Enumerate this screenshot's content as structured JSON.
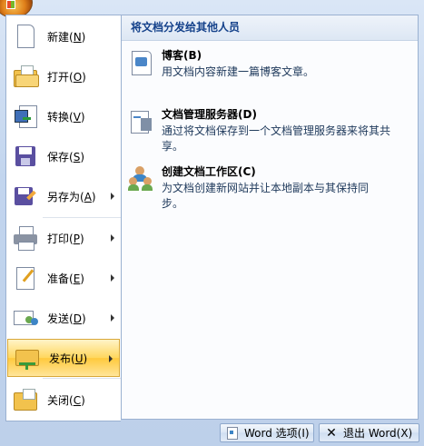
{
  "menu": {
    "items": [
      {
        "name": "menu-item-new",
        "icon": "new-document-icon",
        "label": "新建(",
        "key": "N",
        "end": ")",
        "arrow": false
      },
      {
        "name": "menu-item-open",
        "icon": "open-folder-icon",
        "label": "打开(",
        "key": "O",
        "end": ")",
        "arrow": false
      },
      {
        "name": "menu-item-convert",
        "icon": "convert-icon",
        "label": "转换(",
        "key": "V",
        "end": ")",
        "arrow": false
      },
      {
        "name": "menu-item-save",
        "icon": "save-icon",
        "label": "保存(",
        "key": "S",
        "end": ")",
        "arrow": false
      },
      {
        "name": "menu-item-save-as",
        "icon": "save-as-icon",
        "label": "另存为(",
        "key": "A",
        "end": ")",
        "arrow": true
      },
      {
        "name": "menu-item-print",
        "icon": "printer-icon",
        "label": "打印(",
        "key": "P",
        "end": ")",
        "arrow": true
      },
      {
        "name": "menu-item-prepare",
        "icon": "prepare-icon",
        "label": "准备(",
        "key": "E",
        "end": ")",
        "arrow": true
      },
      {
        "name": "menu-item-send",
        "icon": "send-icon",
        "label": "发送(",
        "key": "D",
        "end": ")",
        "arrow": true
      },
      {
        "name": "menu-item-publish",
        "icon": "publish-icon",
        "label": "发布(",
        "key": "U",
        "end": ")",
        "arrow": true,
        "selected": true
      },
      {
        "name": "menu-item-close",
        "icon": "close-folder-icon",
        "label": "关闭(",
        "key": "C",
        "end": ")",
        "arrow": false
      }
    ]
  },
  "panel": {
    "title": "将文档分发给其他人员",
    "options": [
      {
        "name": "option-blog",
        "icon": "blog-icon",
        "title": "博客(B)",
        "desc": "用文档内容新建一篇博客文章。"
      },
      {
        "name": "option-doc-server",
        "icon": "document-server-icon",
        "title": "文档管理服务器(D)",
        "desc": "通过将文档保存到一个文档管理服务器来将其共享。"
      },
      {
        "name": "option-workspace",
        "icon": "workspace-icon",
        "title": "创建文档工作区(C)",
        "desc": "为文档创建新网站并让本地副本与其保持同步。"
      }
    ]
  },
  "footer": {
    "options_label": "Word 选项(I)",
    "exit_label": "退出 Word(X)"
  },
  "colors": {
    "selected_gradient_mid": "#ffd75e",
    "panel_title": "#15428b",
    "frame": "#c2d5ee"
  }
}
